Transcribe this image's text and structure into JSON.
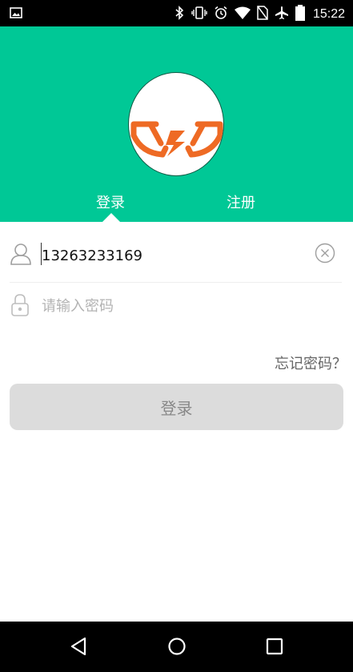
{
  "status_bar": {
    "time": "15:22",
    "icons": [
      "image-icon",
      "bluetooth-icon",
      "vibrate-icon",
      "alarm-icon",
      "wifi-icon",
      "no-sim-icon",
      "airplane-icon",
      "battery-icon"
    ]
  },
  "colors": {
    "accent": "#00c896",
    "logo_orange": "#ee6a24"
  },
  "tabs": [
    {
      "label": "登录",
      "active": true
    },
    {
      "label": "注册",
      "active": false
    }
  ],
  "form": {
    "username_value": "13263233169",
    "password_placeholder": "请输入密码",
    "forgot_label": "忘记密码？",
    "login_button_label": "登录"
  },
  "nav_bar": {
    "icons": [
      "back-icon",
      "home-icon",
      "recents-icon"
    ]
  }
}
